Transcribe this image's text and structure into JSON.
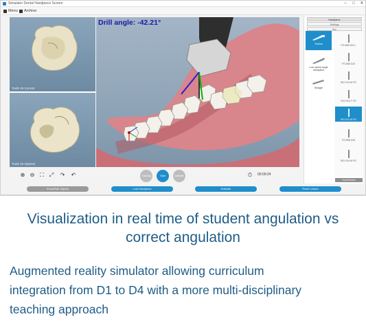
{
  "window": {
    "title": "Simulator Dental Handpiece Screen",
    "controls": {
      "minimize": "–",
      "maximize": "□",
      "close": "✕"
    }
  },
  "menu": {
    "items": [
      {
        "label": "Menu",
        "icon": "menu-icon"
      },
      {
        "label": "Archive",
        "icon": "archive-icon"
      }
    ]
  },
  "views": {
    "top_caption": "Tooth 25 Current",
    "bottom_caption": "Tooth 25 Optimal"
  },
  "main_view": {
    "drill_angle": "Drill angle: -42.21°"
  },
  "right_panel": {
    "tabs": [
      "Handpiece",
      "Settings",
      "Bur"
    ],
    "handpieces": [
      {
        "label": "Turbine",
        "selected": true
      },
      {
        "label": "Low speed angle handpiece",
        "selected": false
      },
      {
        "label": "Straight",
        "selected": false
      }
    ],
    "burs": [
      {
        "label": "FG 806 010 L",
        "selected": false
      },
      {
        "label": "FG 806 010",
        "selected": false
      },
      {
        "label": "ISO 014 M FG",
        "selected": false
      },
      {
        "label": "ISO 014 F FG",
        "selected": false
      },
      {
        "label": "ISO 012 M FG",
        "selected": true
      },
      {
        "label": "FG 805 016",
        "selected": false
      },
      {
        "label": "ISO 014 M FG",
        "selected": false
      }
    ],
    "scroll_label": "Scroll Down"
  },
  "toolbar": {
    "icons": [
      "zoom-in-icon",
      "zoom-out-icon",
      "fit-view-icon",
      "expand-view-icon",
      "redo-icon",
      "undo-icon"
    ],
    "round_buttons": [
      {
        "label": "Tracking",
        "active": false
      },
      {
        "label": "Start",
        "active": true
      },
      {
        "label": "Calibrate",
        "active": false
      }
    ],
    "timer": "00:00:24"
  },
  "bottom_buttons": [
    {
      "label": "Show/Hide Objects",
      "style": "gray"
    },
    {
      "label": "Lock Handpiece",
      "style": "blue"
    },
    {
      "label": "Evaluate",
      "style": "blue"
    },
    {
      "label": "Reset Lesson",
      "style": "blue"
    }
  ],
  "caption": {
    "line1": "Visualization in real time of student angulation vs",
    "line2": "correct angulation"
  },
  "body": {
    "line1": "Augmented reality simulator allowing curriculum",
    "line2": "integration from D1 to D4 with a more multi-disciplinary",
    "line3": "teaching approach"
  },
  "colors": {
    "accent": "#1f8ecb",
    "caption_text": "#1f5c86",
    "drill_angle_text": "#1a1aa6"
  }
}
